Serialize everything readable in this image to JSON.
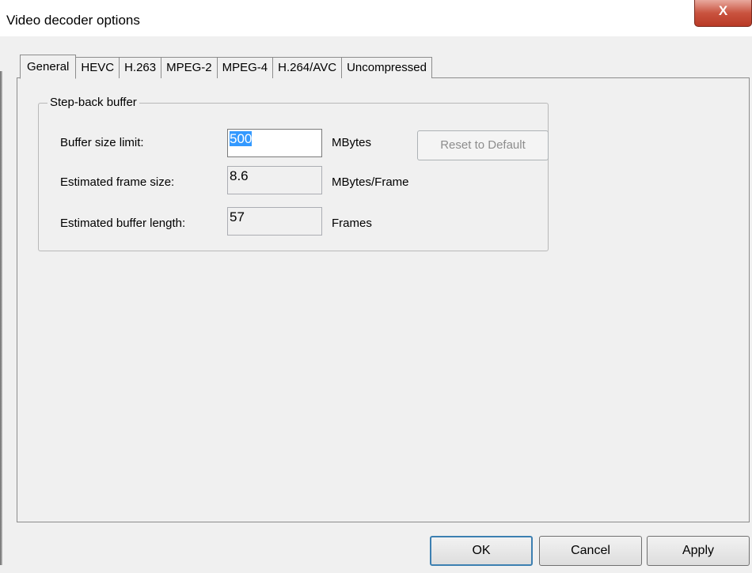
{
  "window": {
    "title": "Video decoder options",
    "close_label": "X"
  },
  "tabs": [
    {
      "label": "General",
      "active": true
    },
    {
      "label": "HEVC",
      "active": false
    },
    {
      "label": "H.263",
      "active": false
    },
    {
      "label": "MPEG-2",
      "active": false
    },
    {
      "label": "MPEG-4",
      "active": false
    },
    {
      "label": "H.264/AVC",
      "active": false
    },
    {
      "label": "Uncompressed",
      "active": false
    }
  ],
  "step_back": {
    "group_title": "Step-back buffer",
    "buffer_size_label": "Buffer size limit:",
    "buffer_size_value": "500",
    "buffer_size_unit": "MBytes",
    "frame_size_label": "Estimated frame size:",
    "frame_size_value": "8.6",
    "frame_size_unit": "MBytes/Frame",
    "buffer_length_label": "Estimated buffer length:",
    "buffer_length_value": "57",
    "buffer_length_unit": "Frames",
    "reset_label": "Reset to Default"
  },
  "buttons": {
    "ok": "OK",
    "cancel": "Cancel",
    "apply": "Apply"
  }
}
